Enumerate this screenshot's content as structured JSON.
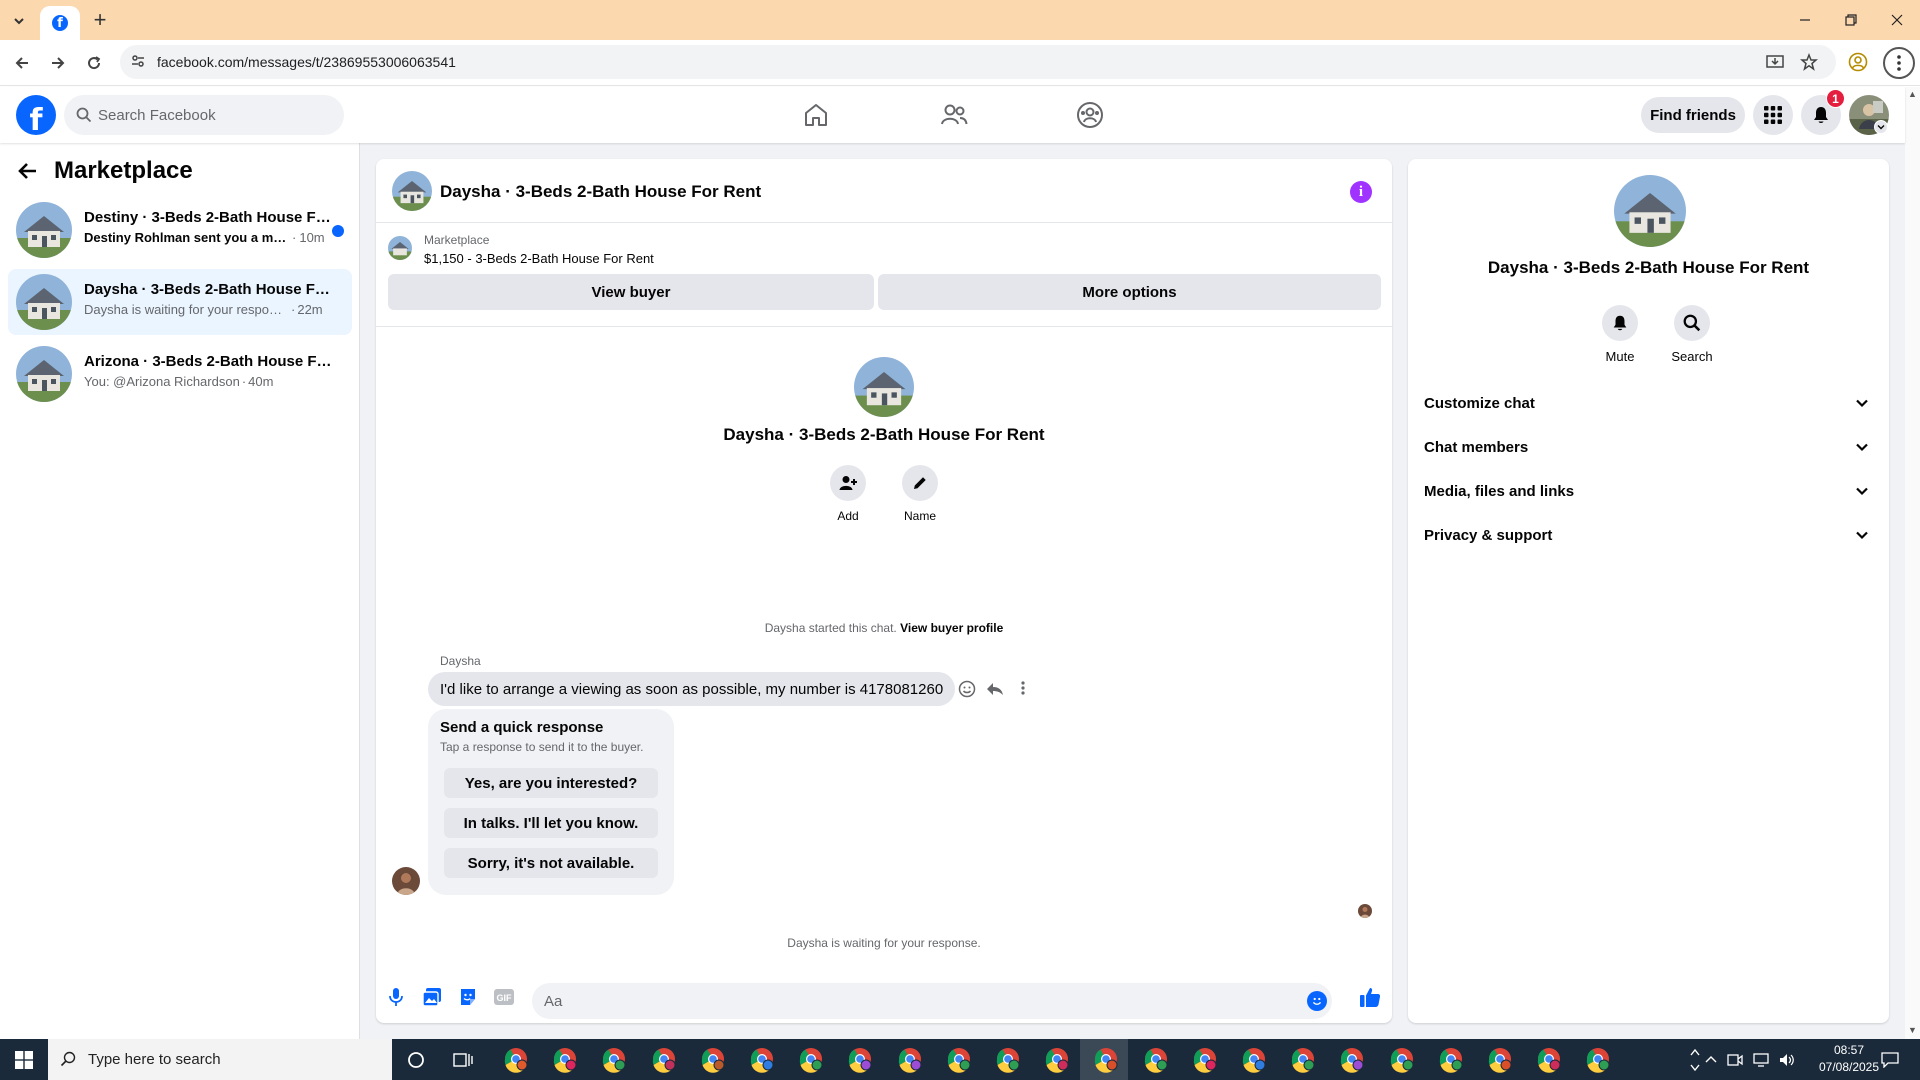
{
  "browser": {
    "url": "facebook.com/messages/t/23869553006063541"
  },
  "fb": {
    "logo": "f",
    "search_placeholder": "Search Facebook",
    "find_friends": "Find friends",
    "notification_count": "1"
  },
  "sidebar": {
    "title": "Marketplace",
    "conversations": [
      {
        "name": "Destiny · 3-Beds 2-Bath House For Rent",
        "snippet": "Destiny Rohlman sent you a message.",
        "time": "10m",
        "unread": true
      },
      {
        "name": "Daysha · 3-Beds 2-Bath House For Rent",
        "snippet": "Daysha is waiting for your response.",
        "time": "22m",
        "unread": false
      },
      {
        "name": "Arizona · 3-Beds 2-Bath House For Rent",
        "snippet": "You: @Arizona Richardson",
        "time": "40m",
        "unread": false
      }
    ]
  },
  "chat": {
    "title": "Daysha · 3-Beds 2-Bath House For Rent",
    "marketplace_label": "Marketplace",
    "listing": "$1,150 - 3-Beds 2-Bath House For Rent",
    "view_buyer": "View buyer",
    "more_options": "More options",
    "profile_name": "Daysha · 3-Beds 2-Bath House For Rent",
    "add_label": "Add",
    "name_label": "Name",
    "started_text": "Daysha started this chat.",
    "view_buyer_profile": "View buyer profile",
    "sender": "Daysha",
    "message": "I'd like to arrange a viewing as soon as possible, my number is 4178081260",
    "quick_title": "Send a quick response",
    "quick_subtitle": "Tap a response to send it to the buyer.",
    "quick_responses": [
      "Yes, are you interested?",
      "In talks. I'll let you know.",
      "Sorry, it's not available."
    ],
    "waiting": "Daysha is waiting for your response.",
    "composer_placeholder": "Aa"
  },
  "details": {
    "name": "Daysha · 3-Beds 2-Bath House For Rent",
    "mute": "Mute",
    "search": "Search",
    "sections": [
      "Customize chat",
      "Chat members",
      "Media, files and links",
      "Privacy & support"
    ]
  },
  "taskbar": {
    "search_placeholder": "Type here to search",
    "time": "08:57",
    "date": "07/08/2025"
  },
  "colors": {
    "fb_blue": "#0866ff",
    "messenger_purple": "#a033ff",
    "tabbar": "#fbd8ae",
    "taskbar": "#1b2a3a"
  }
}
